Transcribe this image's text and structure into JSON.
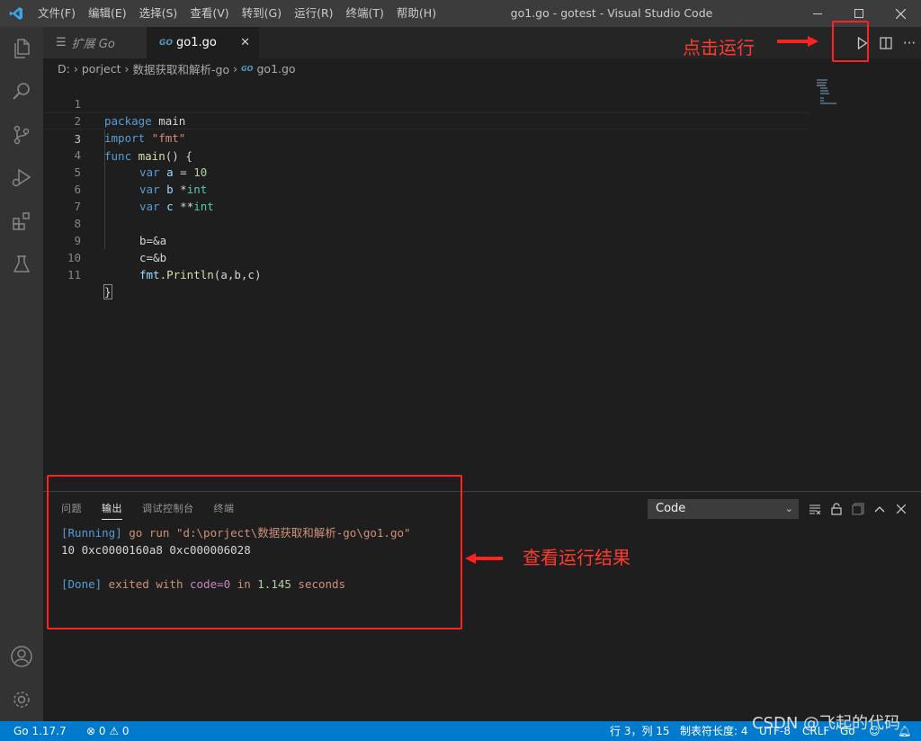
{
  "titlebar": {
    "menu": [
      "文件(F)",
      "编辑(E)",
      "选择(S)",
      "查看(V)",
      "转到(G)",
      "运行(R)",
      "终端(T)",
      "帮助(H)"
    ],
    "window_title": "go1.go - gotest - Visual Studio Code"
  },
  "activity": [
    "files-icon",
    "search-icon",
    "source-control-icon",
    "run-debug-icon",
    "extensions-icon",
    "testing-icon",
    "account-icon",
    "settings-gear-icon"
  ],
  "tabs": {
    "inactive": {
      "label": "扩展 Go"
    },
    "active": {
      "label": "go1.go",
      "badge": "GO"
    }
  },
  "breadcrumb": {
    "items": [
      "D:",
      "porject",
      "数据获取和解析-go",
      "go1.go"
    ]
  },
  "editor": {
    "line_numbers": [
      "1",
      "2",
      "3",
      "4",
      "5",
      "6",
      "7",
      "8",
      "9",
      "10",
      "11"
    ],
    "lines": {
      "l1": {
        "kw": "package",
        "rest": " main"
      },
      "l2": {
        "kw": "import",
        "str": " \"fmt\""
      },
      "l3": {
        "kw": "func",
        "fn": " main",
        "rest": "() {"
      },
      "l4": {
        "kw": "var",
        "id": " a",
        "op": " = ",
        "num": "10"
      },
      "l5": {
        "kw": "var",
        "id": " b",
        "op": " *",
        "type": "int"
      },
      "l6": {
        "kw": "var",
        "id": " c",
        "op": " **",
        "type": "int"
      },
      "l8": {
        "text": "b=&a"
      },
      "l9": {
        "text": "c=&b"
      },
      "l10": {
        "pkg": "fmt",
        "dot": ".",
        "fn": "Println",
        "rest": "(a,b,c)"
      },
      "l11": {
        "text": "}"
      }
    },
    "current_line": 3
  },
  "panel": {
    "tabs": [
      "问题",
      "输出",
      "调试控制台",
      "终端"
    ],
    "active_tab": "输出",
    "channel": "Code",
    "output": {
      "line1_tag": "[Running]",
      "line1_cmd": " go run \"d:\\porject\\数据获取和解析-go\\go1.go\"",
      "line2": "10 0xc0000160a8 0xc000006028",
      "line4_tag": "[Done]",
      "line4_a": " exited with ",
      "line4_code": "code=0",
      "line4_b": " in ",
      "line4_sec": "1.145",
      "line4_c": " seconds"
    }
  },
  "statusbar": {
    "go_version": "Go 1.17.7",
    "problems": "⊗ 0 ⚠ 0",
    "position": "行 3，列 15",
    "tab_size": "制表符长度: 4",
    "encoding": "UTF-8",
    "eol": "CRLF",
    "language": "Go"
  },
  "annotations": {
    "run_hint": "点击运行",
    "result_hint": "查看运行结果",
    "watermark": "CSDN @飞起的代码"
  },
  "colors": {
    "annotation": "#ff2222",
    "statusbar": "#007acc",
    "vscode_logo": "#3ba5e8"
  }
}
